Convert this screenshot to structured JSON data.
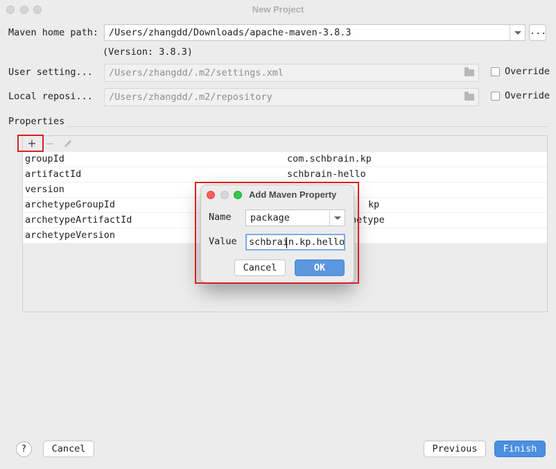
{
  "window": {
    "title": "New Project"
  },
  "form": {
    "maven_home": {
      "label": "Maven home path:",
      "value": "/Users/zhangdd/Downloads/apache-maven-3.8.3",
      "browse_label": "..."
    },
    "version_note": "(Version: 3.8.3)",
    "user_settings": {
      "label": "User setting...",
      "value": "/Users/zhangdd/.m2/settings.xml",
      "override_label": "Override"
    },
    "local_repo": {
      "label": "Local reposi...",
      "value": "/Users/zhangdd/.m2/repository",
      "override_label": "Override"
    }
  },
  "properties": {
    "title": "Properties",
    "toolbar": {
      "add": "+",
      "remove": "−"
    },
    "rows": [
      {
        "key": "groupId",
        "value": "com.schbrain.kp"
      },
      {
        "key": "artifactId",
        "value": "schbrain-hello"
      },
      {
        "key": "version",
        "value": ""
      },
      {
        "key": "archetypeGroupId",
        "value": "kp"
      },
      {
        "key": "archetypeArtifactId",
        "value": "hetype"
      },
      {
        "key": "archetypeVersion",
        "value": ""
      }
    ]
  },
  "footer": {
    "help": "?",
    "cancel": "Cancel",
    "previous": "Previous",
    "finish": "Finish"
  },
  "dialog": {
    "title": "Add Maven Property",
    "name_label": "Name",
    "name_value": "package",
    "value_label": "Value",
    "value_value": "schbrain.kp.hello",
    "cancel": "Cancel",
    "ok": "OK"
  },
  "colors": {
    "accent": "#4a8fe0",
    "highlight_border": "#d62222",
    "traffic_red": "#fc605c",
    "traffic_green": "#34c84a"
  }
}
